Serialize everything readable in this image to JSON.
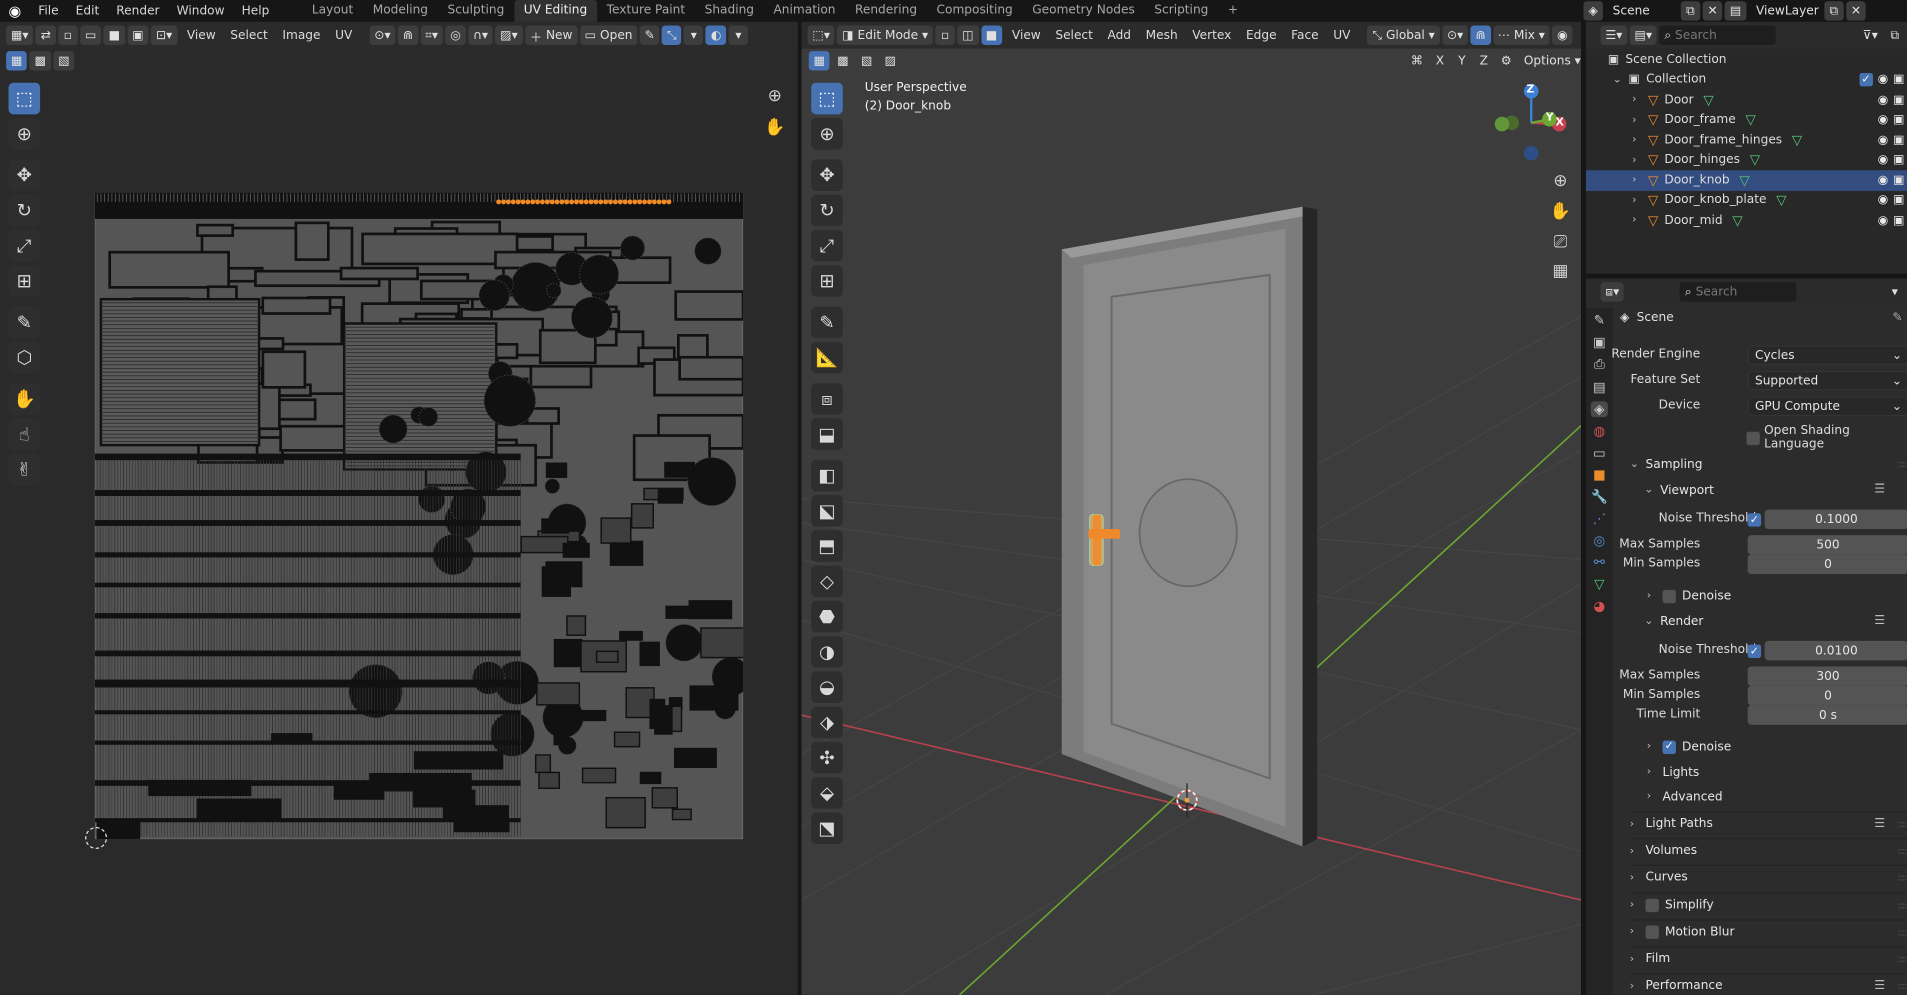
{
  "topbar": {
    "menus": [
      "File",
      "Edit",
      "Render",
      "Window",
      "Help"
    ],
    "workspaces": [
      "Layout",
      "Modeling",
      "Sculpting",
      "UV Editing",
      "Texture Paint",
      "Shading",
      "Animation",
      "Rendering",
      "Compositing",
      "Geometry Nodes",
      "Scripting"
    ],
    "active_workspace": "UV Editing",
    "add_tab": "+",
    "scene_label": "Scene",
    "viewlayer_label": "ViewLayer"
  },
  "uv_editor": {
    "menus": [
      "View",
      "Select",
      "Image",
      "UV"
    ],
    "new_label": "New",
    "open_label": "Open",
    "image_fill_color": "#555555",
    "island_color": "#111111",
    "selected_edges_color": "#f08a24"
  },
  "viewport": {
    "mode": "Edit Mode",
    "menus": [
      "View",
      "Select",
      "Add",
      "Mesh",
      "Vertex",
      "Edge",
      "Face",
      "UV"
    ],
    "transform_orientation": "Global",
    "shading_blend": "Mix",
    "options_label": "Options",
    "axis_buttons": [
      "X",
      "Y",
      "Z"
    ],
    "overlay_title": "User Perspective",
    "overlay_object": "(2) Door_knob",
    "gizmo": {
      "x": "X",
      "y": "Y",
      "z": "Z"
    },
    "colors": {
      "x_axis": "#c8404f",
      "y_axis": "#6ba82f",
      "z_axis": "#3d80d6",
      "selection": "#f0892c"
    }
  },
  "outliner": {
    "search_placeholder": "Search",
    "root": "Scene Collection",
    "collection": "Collection",
    "objects": [
      {
        "name": "Door",
        "selected": false
      },
      {
        "name": "Door_frame",
        "selected": false
      },
      {
        "name": "Door_frame_hinges",
        "selected": false
      },
      {
        "name": "Door_hinges",
        "selected": false
      },
      {
        "name": "Door_knob",
        "selected": true
      },
      {
        "name": "Door_knob_plate",
        "selected": false
      },
      {
        "name": "Door_mid",
        "selected": false
      }
    ]
  },
  "properties": {
    "search_placeholder": "Search",
    "context": "Scene",
    "render_engine_label": "Render Engine",
    "render_engine": "Cycles",
    "feature_set_label": "Feature Set",
    "feature_set": "Supported",
    "device_label": "Device",
    "device": "GPU Compute",
    "osl_label": "Open Shading Language",
    "sampling": "Sampling",
    "viewport": "Viewport",
    "render": "Render",
    "noise_threshold_label": "Noise Threshold",
    "max_samples_label": "Max Samples",
    "min_samples_label": "Min Samples",
    "time_limit_label": "Time Limit",
    "denoise_label": "Denoise",
    "viewport_values": {
      "noise_threshold": "0.1000",
      "max_samples": "500",
      "min_samples": "0",
      "denoise": false
    },
    "render_values": {
      "noise_threshold": "0.0100",
      "max_samples": "300",
      "min_samples": "0",
      "time_limit": "0 s",
      "denoise": true
    },
    "subpanels": [
      "Lights",
      "Advanced"
    ],
    "panels": [
      "Light Paths",
      "Volumes",
      "Curves",
      "Simplify",
      "Motion Blur",
      "Film",
      "Performance"
    ]
  }
}
